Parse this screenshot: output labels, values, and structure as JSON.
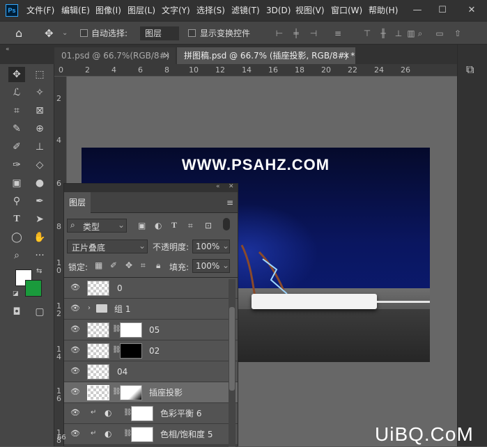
{
  "menubar": {
    "logo": "Ps",
    "items": [
      "文件(F)",
      "编辑(E)",
      "图像(I)",
      "图层(L)",
      "文字(Y)",
      "选择(S)",
      "滤镜(T)",
      "3D(D)",
      "视图(V)",
      "窗口(W)",
      "帮助(H)"
    ]
  },
  "options": {
    "auto_select_label": "自动选择:",
    "auto_select_value": "图层",
    "transform_label": "显示变换控件"
  },
  "tabs": [
    {
      "label": "01.psd @ 66.7%(RGB/8#) *"
    },
    {
      "label": "拼图稿.psd @ 66.7% (插座投影, RGB/8#) *"
    }
  ],
  "ruler_h": [
    "0",
    "2",
    "4",
    "6",
    "8",
    "10",
    "12",
    "14",
    "16",
    "18",
    "20",
    "22",
    "24",
    "26"
  ],
  "ruler_v": [
    "2",
    "4",
    "6",
    "8",
    "1 0",
    "1 2",
    "1 4",
    "1 6",
    "1 8"
  ],
  "canvas": {
    "watermark_text": "WWW.PSAHZ.COM"
  },
  "layers_panel": {
    "title": "图层",
    "filter_label": "类型",
    "blend_mode": "正片叠底",
    "opacity_label": "不透明度:",
    "opacity_value": "100%",
    "lock_label": "锁定:",
    "fill_label": "填充:",
    "fill_value": "100%",
    "layers": [
      {
        "name": "0"
      },
      {
        "name": "组 1"
      },
      {
        "name": "05"
      },
      {
        "name": "02"
      },
      {
        "name": "04"
      },
      {
        "name": "插座投影"
      },
      {
        "name": "色彩平衡 6"
      },
      {
        "name": "色相/饱和度 5"
      }
    ]
  },
  "status": {
    "zoom_fragment": "66"
  },
  "site_watermark": "UiBQ.CoM",
  "colors": {
    "foreground": "#ffffff",
    "background": "#1a9a3c",
    "accent": "#31a8ff"
  }
}
